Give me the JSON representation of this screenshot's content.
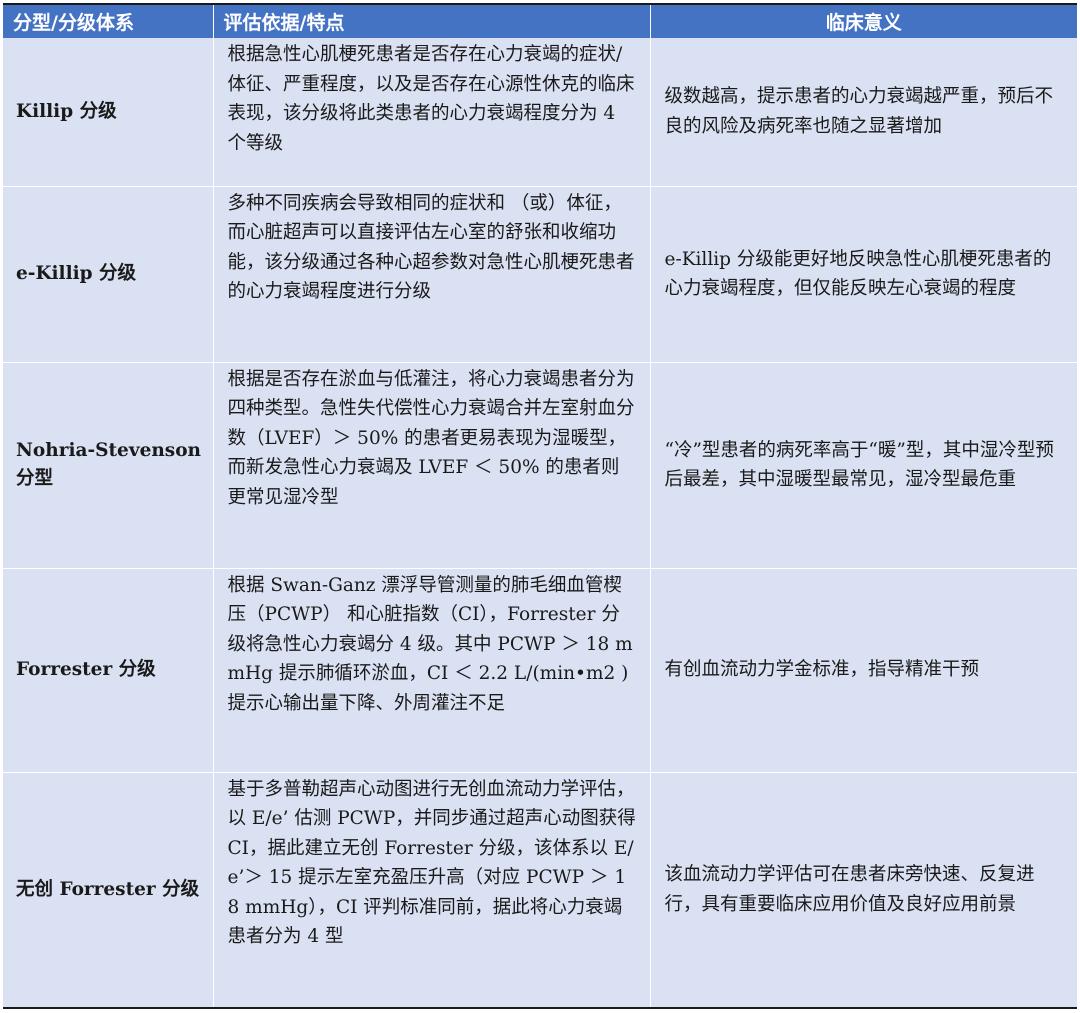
{
  "table": {
    "headers": [
      "分型/分级体系",
      "评估依据/特点",
      "临床意义"
    ],
    "rows": [
      {
        "name": "Killip 分级",
        "basis": "根据急性心肌梗死患者是否存在心力衰竭的症状/体征、严重程度，以及是否存在心源性休克的临床表现，该分级将此类患者的心力衰竭程度分为 4 个等级",
        "significance": "级数越高，提示患者的心力衰竭越严重，预后不良的风险及病死率也随之显著增加"
      },
      {
        "name": "e-Killip 分级",
        "basis": "多种不同疾病会导致相同的症状和 （或）体征，而心脏超声可以直接评估左心室的舒张和收缩功能，该分级通过各种心超参数对急性心肌梗死患者的心力衰竭程度进行分级",
        "significance": "e-Killip 分级能更好地反映急性心肌梗死患者的心力衰竭程度，但仅能反映左心衰竭的程度"
      },
      {
        "name": "Nohria-Stevenson 分型",
        "basis": "根据是否存在淤血与低灌注，将心力衰竭患者分为四种类型。急性失代偿性心力衰竭合并左室射血分数（LVEF）＞ 50% 的患者更易表现为湿暖型，而新发急性心力衰竭及 LVEF ＜ 50% 的患者则更常见湿冷型",
        "significance": "“冷”型患者的病死率高于“暖”型，其中湿冷型预后最差，其中湿暖型最常见，湿冷型最危重"
      },
      {
        "name": "Forrester 分级",
        "basis": "根据 Swan-Ganz 漂浮导管测量的肺毛细血管楔压（PCWP） 和心脏指数（CI），Forrester 分级将急性心力衰竭分 4 级。其中 PCWP ＞ 18 mmHg 提示肺循环淤血，CI ＜ 2.2 L/(min•m2 ) 提示心输出量下降、外周灌注不足",
        "significance": "有创血流动力学金标准，指导精准干预"
      },
      {
        "name": "无创 Forrester 分级",
        "basis": "基于多普勒超声心动图进行无创血流动力学评估，以 E/e’ 估测 PCWP，并同步通过超声心动图获得 CI，据此建立无创 Forrester 分级，该体系以 E/e’＞ 15 提示左室充盈压升高（对应 PCWP ＞ 18 mmHg），CI 评判标准同前，据此将心力衰竭患者分为 4 型",
        "significance": "该血流动力学评估可在患者床旁快速、反复进行，具有重要临床应用价值及良好应用前景"
      }
    ]
  }
}
